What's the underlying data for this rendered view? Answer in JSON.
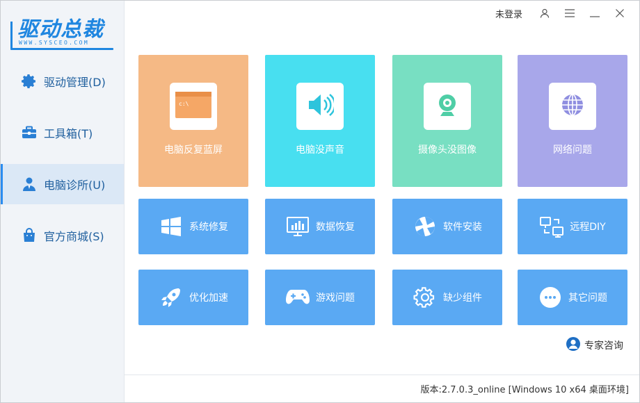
{
  "logo": {
    "title": "驱动总裁",
    "subtitle": "WWW.SYSCEO.COM"
  },
  "sidebar": {
    "items": [
      {
        "label": "驱动管理(D)",
        "icon": "gear-icon"
      },
      {
        "label": "工具箱(T)",
        "icon": "toolbox-icon"
      },
      {
        "label": "电脑诊所(U)",
        "icon": "doctor-icon",
        "active": true
      },
      {
        "label": "官方商城(S)",
        "icon": "shopping-bag-icon"
      }
    ]
  },
  "topbar": {
    "login": "未登录"
  },
  "big_tiles": [
    {
      "label": "电脑反复蓝屏",
      "color": "#f5b985",
      "icon": "bluescreen-window-icon"
    },
    {
      "label": "电脑没声音",
      "color": "#48dff0",
      "icon": "speaker-icon"
    },
    {
      "label": "摄像头没图像",
      "color": "#78dfc2",
      "icon": "webcam-icon"
    },
    {
      "label": "网络问题",
      "color": "#a8a7ea",
      "icon": "globe-icon"
    }
  ],
  "row2": [
    {
      "label": "系统修复",
      "icon": "windows-logo-icon"
    },
    {
      "label": "数据恢复",
      "icon": "monitor-chart-icon"
    },
    {
      "label": "软件安装",
      "icon": "aperture-icon"
    },
    {
      "label": "远程DIY",
      "icon": "remote-screens-icon"
    }
  ],
  "row3": [
    {
      "label": "优化加速",
      "icon": "rocket-icon"
    },
    {
      "label": "游戏问题",
      "icon": "gamepad-icon"
    },
    {
      "label": "缺少组件",
      "icon": "gear-outline-icon"
    },
    {
      "label": "其它问题",
      "icon": "more-dots-icon"
    }
  ],
  "expert": {
    "label": "专家咨询"
  },
  "footer": {
    "version": "版本:2.7.0.3_online [Windows 10 x64 桌面环境]"
  },
  "colors": {
    "accent": "#1f86e0",
    "small_tile": "#5aa9f3",
    "sidebar_bg": "#f1f4f8",
    "sidebar_active": "#dbe8f6"
  }
}
